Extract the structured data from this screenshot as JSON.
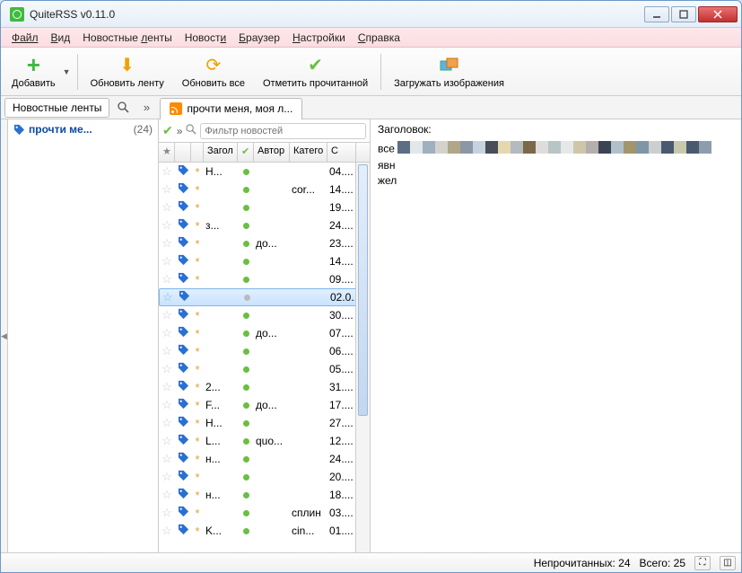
{
  "window": {
    "title": "QuiteRSS v0.11.0"
  },
  "menu": {
    "file": "Файл",
    "view": "Вид",
    "feeds": "Новостные ленты",
    "news": "Новости",
    "browser": "Браузер",
    "settings": "Настройки",
    "help": "Справка"
  },
  "toolbar": {
    "add": "Добавить",
    "update_feed": "Обновить ленту",
    "update_all": "Обновить все",
    "mark_read": "Отметить прочитанной",
    "load_images": "Загружать изображения"
  },
  "tabs": {
    "feeds_btn": "Новостные ленты",
    "chevron": "»",
    "tab1": "прочти меня, моя л..."
  },
  "sidebar": {
    "feed_name": "прочти ме...",
    "feed_count": "(24)"
  },
  "filter": {
    "placeholder": "Фильтр новостей",
    "chevron": "»"
  },
  "table": {
    "headers": {
      "title": "Загол",
      "author": "Автор",
      "cat": "Катего",
      "date": "С"
    },
    "rows": [
      {
        "d": "*",
        "title": "Н...",
        "author": "",
        "cat": "",
        "date": "04...."
      },
      {
        "d": "*",
        "title": "",
        "author": "",
        "cat": "cor...",
        "date": "14...."
      },
      {
        "d": "*",
        "title": "",
        "author": "",
        "cat": "",
        "date": "19...."
      },
      {
        "d": "*",
        "title": "з...",
        "author": "",
        "cat": "",
        "date": "24...."
      },
      {
        "d": "*",
        "title": "",
        "author": "до...",
        "cat": "",
        "date": "23...."
      },
      {
        "d": "*",
        "title": "",
        "author": "",
        "cat": "",
        "date": "14...."
      },
      {
        "d": "*",
        "title": "",
        "author": "",
        "cat": "",
        "date": "09...."
      },
      {
        "d": "",
        "title": "",
        "author": "",
        "cat": "",
        "date": "02.0..",
        "selected": true
      },
      {
        "d": "*",
        "title": "",
        "author": "",
        "cat": "",
        "date": "30...."
      },
      {
        "d": "*",
        "title": "",
        "author": "до...",
        "cat": "",
        "date": "07...."
      },
      {
        "d": "*",
        "title": "",
        "author": "",
        "cat": "",
        "date": "06...."
      },
      {
        "d": "*",
        "title": "",
        "author": "",
        "cat": "",
        "date": "05...."
      },
      {
        "d": "*",
        "title": "2...",
        "author": "",
        "cat": "",
        "date": "31...."
      },
      {
        "d": "*",
        "title": "F...",
        "author": "до...",
        "cat": "",
        "date": "17...."
      },
      {
        "d": "*",
        "title": "Н...",
        "author": "",
        "cat": "",
        "date": "27...."
      },
      {
        "d": "*",
        "title": "L...",
        "author": "quo...",
        "cat": "",
        "date": "12...."
      },
      {
        "d": "*",
        "title": "н...",
        "author": "",
        "cat": "",
        "date": "24...."
      },
      {
        "d": "*",
        "title": "",
        "author": "",
        "cat": "",
        "date": "20...."
      },
      {
        "d": "*",
        "title": "н...",
        "author": "",
        "cat": "",
        "date": "18...."
      },
      {
        "d": "*",
        "title": "",
        "author": "",
        "cat": "сплин",
        "date": "03...."
      },
      {
        "d": "*",
        "title": "K...",
        "author": "",
        "cat": "cin...",
        "date": "01...."
      }
    ]
  },
  "right": {
    "header": "Заголовок:",
    "line1": "все",
    "line2": "явн",
    "line3": "жел"
  },
  "status": {
    "unread": "Непрочитанных: 24",
    "total": "Всего: 25"
  },
  "mosaic_colors": [
    "#5b6e84",
    "#e2e7ea",
    "#9fb0bf",
    "#d3d2cc",
    "#b2a688",
    "#8b97a7",
    "#c7d2df",
    "#494e58",
    "#e4d8b0",
    "#b4babd",
    "#7a6848",
    "#dedddc",
    "#b9c4c4",
    "#e4e9e7",
    "#cfc6a9",
    "#b4afad",
    "#3b4455",
    "#b0c0cb",
    "#a3956b",
    "#7f96a9",
    "#cbcfd0",
    "#4a5970",
    "#c7c9ad",
    "#4a5970",
    "#8d9dad"
  ]
}
